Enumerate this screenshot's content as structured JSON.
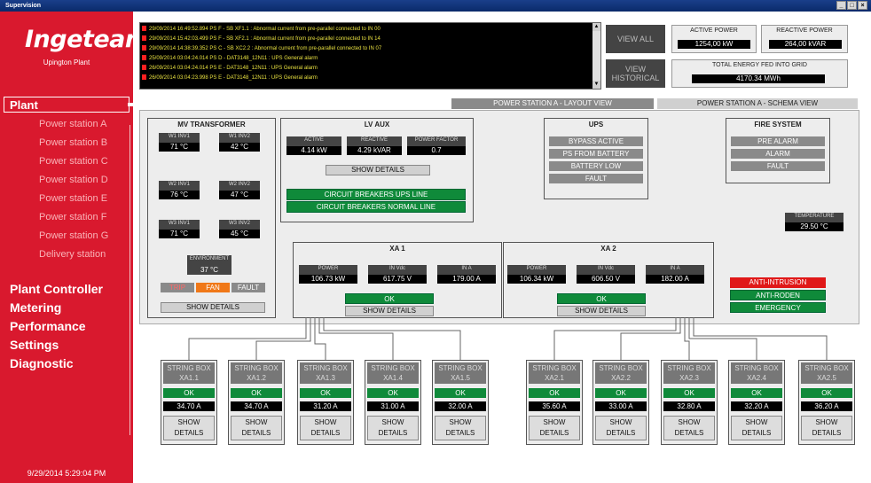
{
  "window": {
    "title": "Supervision",
    "controls": [
      "_",
      "□",
      "×"
    ]
  },
  "sidebar": {
    "logo": "Ingeteam",
    "plant_name": "Upington Plant",
    "plant_label": "Plant",
    "stations": [
      "Power station A",
      "Power station B",
      "Power station C",
      "Power station D",
      "Power station E",
      "Power station F",
      "Power station G",
      "Delivery station"
    ],
    "menu": [
      "Plant Controller",
      "Metering",
      "Performance",
      "Settings",
      "Diagnostic"
    ],
    "datetime": "9/29/2014 5:29:04 PM"
  },
  "alarms": [
    "29/09/2014 16:49:52.894 PS F - SB XF1.1 : Abnormal current from pre-parallel connected to IN 00",
    "29/09/2014 15:42:03.499 PS F - SB XF2.1 : Abnormal current from pre-parallel connected to IN 14",
    "29/09/2014 14:38:39.352 PS C - SB XC2.2 : Abnormal current from pre-parallel connected to IN 07",
    "25/09/2014 03:04:24.014 PS D - DAT3148_12N11 : UPS General alarm",
    "26/09/2014 03:04:24.014 PS E - DAT3148_12N11 : UPS General alarm",
    "26/09/2014 03:04:23.998 PS E - DAT3148_12N11 : UPS General alarm"
  ],
  "top": {
    "view_all": "VIEW ALL",
    "view_historical": "VIEW HISTORICAL",
    "active_power_label": "ACTIVE POWER",
    "active_power": "1254,00 kW",
    "reactive_power_label": "REACTIVE POWER",
    "reactive_power": "264,00 kVAR",
    "energy_label": "TOTAL ENERGY FED INTO GRID",
    "energy": "4170.34 MWh"
  },
  "tabs": {
    "layout": "POWER STATION A - LAYOUT VIEW",
    "schema": "POWER STATION A - SCHEMA VIEW"
  },
  "mv": {
    "title": "MV TRANSFORMER",
    "sensors": [
      {
        "label": "W1 INV1",
        "value": "71 °C"
      },
      {
        "label": "W1 INV2",
        "value": "42 °C"
      },
      {
        "label": "W2 INV1",
        "value": "76 °C"
      },
      {
        "label": "W2 INV2",
        "value": "47 °C"
      },
      {
        "label": "W3 INV1",
        "value": "71 °C"
      },
      {
        "label": "W3 INV2",
        "value": "45 °C"
      }
    ],
    "environment_label": "ENVIRONMENT",
    "environment": "37 °C",
    "trip": "TRIP",
    "fan": "FAN",
    "fault": "FAULT",
    "show_details": "SHOW DETAILS"
  },
  "lvaux": {
    "title": "LV AUX",
    "cols": [
      {
        "label": "ACTIVE",
        "value": "4.14 kW"
      },
      {
        "label": "REACTIVE",
        "value": "4.29 kVAR"
      },
      {
        "label": "POWER FACTOR",
        "value": "0.7"
      }
    ],
    "show_details": "SHOW DETAILS",
    "ups_line": "CIRCUIT BREAKERS UPS LINE",
    "normal_line": "CIRCUIT BREAKERS NORMAL LINE"
  },
  "ups": {
    "title": "UPS",
    "items": [
      "BYPASS ACTIVE",
      "PS FROM BATTERY",
      "BATTERY LOW",
      "FAULT"
    ]
  },
  "fire": {
    "title": "FIRE SYSTEM",
    "items": [
      "PRE ALARM",
      "ALARM",
      "FAULT"
    ],
    "temperature_label": "TEMPERATURE",
    "temperature": "29.50 °C"
  },
  "security": {
    "anti_intrusion": "ANTI-INTRUSION",
    "anti_roden": "ANTI-RODEN",
    "emergency": "EMERGENCY"
  },
  "xa1": {
    "title": "XA 1",
    "cols": [
      {
        "label": "POWER",
        "value": "106.73 kW"
      },
      {
        "label": "IN Vdc",
        "value": "617.75 V"
      },
      {
        "label": "IN A",
        "value": "179.00 A"
      }
    ],
    "status": "OK",
    "show_details": "SHOW DETAILS"
  },
  "xa2": {
    "title": "XA 2",
    "cols": [
      {
        "label": "POWER",
        "value": "106.34 kW"
      },
      {
        "label": "IN Vdc",
        "value": "606.50 V"
      },
      {
        "label": "IN A",
        "value": "182.00 A"
      }
    ],
    "status": "OK",
    "show_details": "SHOW DETAILS"
  },
  "string_boxes": [
    {
      "title": "STRING BOX",
      "id": "XA1.1",
      "status": "OK",
      "current": "34.70 A",
      "show": "SHOW",
      "details": "DETAILS"
    },
    {
      "title": "STRING BOX",
      "id": "XA1.2",
      "status": "OK",
      "current": "34.70 A",
      "show": "SHOW",
      "details": "DETAILS"
    },
    {
      "title": "STRING BOX",
      "id": "XA1.3",
      "status": "OK",
      "current": "31.20 A",
      "show": "SHOW",
      "details": "DETAILS"
    },
    {
      "title": "STRING BOX",
      "id": "XA1.4",
      "status": "OK",
      "current": "31.00 A",
      "show": "SHOW",
      "details": "DETAILS"
    },
    {
      "title": "STRING BOX",
      "id": "XA1.5",
      "status": "OK",
      "current": "32.00 A",
      "show": "SHOW",
      "details": "DETAILS"
    },
    {
      "title": "STRING BOX",
      "id": "XA2.1",
      "status": "OK",
      "current": "35.60 A",
      "show": "SHOW",
      "details": "DETAILS"
    },
    {
      "title": "STRING BOX",
      "id": "XA2.2",
      "status": "OK",
      "current": "33.00 A",
      "show": "SHOW",
      "details": "DETAILS"
    },
    {
      "title": "STRING BOX",
      "id": "XA2.3",
      "status": "OK",
      "current": "32.80 A",
      "show": "SHOW",
      "details": "DETAILS"
    },
    {
      "title": "STRING BOX",
      "id": "XA2.4",
      "status": "OK",
      "current": "32.20 A",
      "show": "SHOW",
      "details": "DETAILS"
    },
    {
      "title": "STRING BOX",
      "id": "XA2.5",
      "status": "OK",
      "current": "36.20 A",
      "show": "SHOW",
      "details": "DETAILS"
    }
  ],
  "colors": {
    "brand_red": "#d9192e",
    "ok_green": "#0f8a3a",
    "alarm_red": "#e01818",
    "fan_orange": "#f07818",
    "alarm_text": "#e8e040"
  }
}
